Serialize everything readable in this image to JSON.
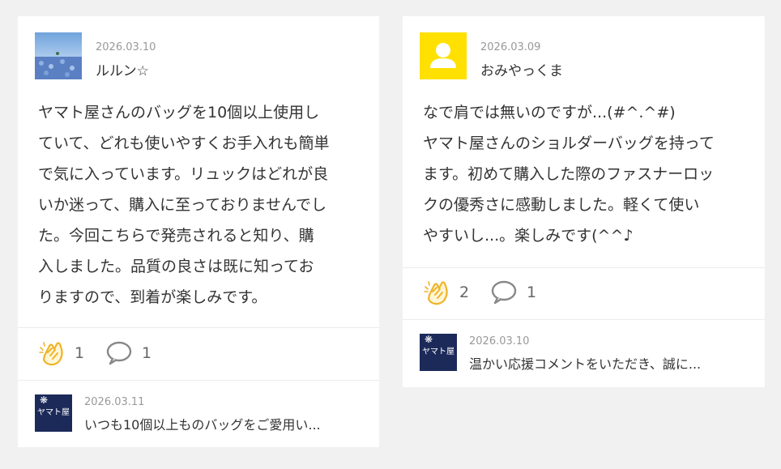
{
  "reviews": [
    {
      "date": "2026.03.10",
      "user": "ルルン☆",
      "avatar": "flower-field-photo",
      "lines": [
        "ヤマト屋さんのバッグを10個以上使用し",
        "ていて、どれも使いやすくお手入れも簡単",
        "で気に入っています。リュックはどれが良",
        "いか迷って、購入に至っておりませんでし",
        "た。今回こちらで発売されると知り、購",
        "入しました。品質の良さは既に知ってお",
        "りますので、到着が楽しみです。"
      ],
      "claps": "1",
      "comments": "1",
      "reply": {
        "logo": "ヤマト屋",
        "date": "2026.03.11",
        "text": "いつも10個以上ものバッグをご愛用い..."
      }
    },
    {
      "date": "2026.03.09",
      "user": "おみやっくま",
      "avatar": "default-user-icon",
      "avatar_color": "#ffe000",
      "lines": [
        "なで肩では無いのですが...(#^.^#)",
        "ヤマト屋さんのショルダーバッグを持って",
        "ます。初めて購入した際のファスナーロッ",
        "クの優秀さに感動しました。軽くて使い",
        "やすいし...。楽しみです(^^♪"
      ],
      "claps": "2",
      "comments": "1",
      "reply": {
        "logo": "ヤマト屋",
        "date": "2026.03.10",
        "text": "温かい応援コメントをいただき、誠に..."
      }
    }
  ],
  "colors": {
    "clap_icon": "#f0b429",
    "comment_icon": "#888888",
    "brand_navy": "#1c2a5a"
  }
}
